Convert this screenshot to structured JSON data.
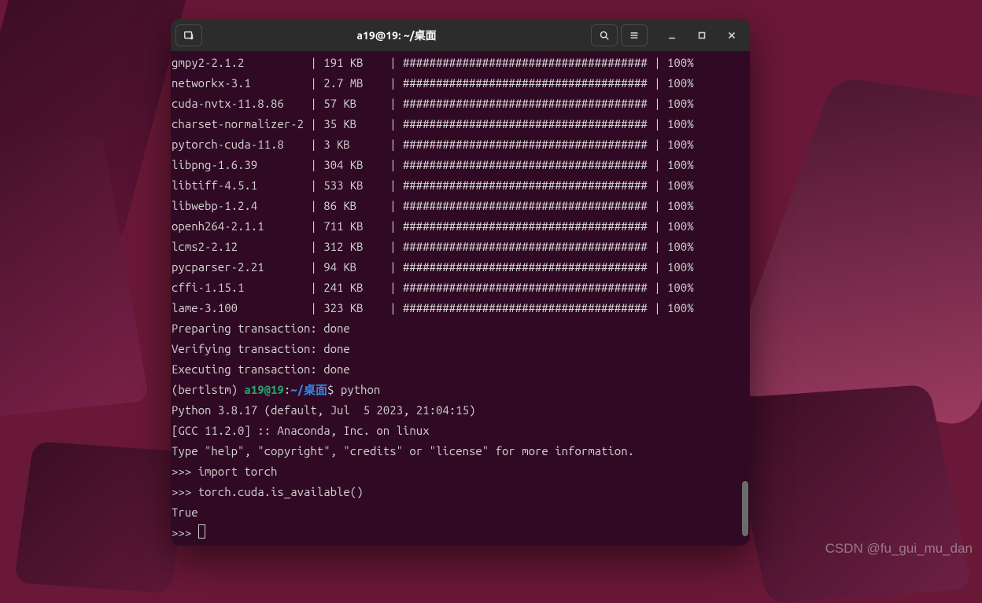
{
  "window": {
    "title": "a19@19: ~/桌面"
  },
  "downloads": [
    {
      "pkg": "gmpy2-2.1.2",
      "size": "191 KB",
      "bar": "#####################################",
      "pct": "100%"
    },
    {
      "pkg": "networkx-3.1",
      "size": "2.7 MB",
      "bar": "#####################################",
      "pct": "100%"
    },
    {
      "pkg": "cuda-nvtx-11.8.86",
      "size": "57 KB",
      "bar": "#####################################",
      "pct": "100%"
    },
    {
      "pkg": "charset-normalizer-2",
      "size": "35 KB",
      "bar": "#####################################",
      "pct": "100%"
    },
    {
      "pkg": "pytorch-cuda-11.8",
      "size": "3 KB",
      "bar": "#####################################",
      "pct": "100%"
    },
    {
      "pkg": "libpng-1.6.39",
      "size": "304 KB",
      "bar": "#####################################",
      "pct": "100%"
    },
    {
      "pkg": "libtiff-4.5.1",
      "size": "533 KB",
      "bar": "#####################################",
      "pct": "100%"
    },
    {
      "pkg": "libwebp-1.2.4",
      "size": "86 KB",
      "bar": "#####################################",
      "pct": "100%"
    },
    {
      "pkg": "openh264-2.1.1",
      "size": "711 KB",
      "bar": "#####################################",
      "pct": "100%"
    },
    {
      "pkg": "lcms2-2.12",
      "size": "312 KB",
      "bar": "#####################################",
      "pct": "100%"
    },
    {
      "pkg": "pycparser-2.21",
      "size": "94 KB",
      "bar": "#####################################",
      "pct": "100%"
    },
    {
      "pkg": "cffi-1.15.1",
      "size": "241 KB",
      "bar": "#####################################",
      "pct": "100%"
    },
    {
      "pkg": "lame-3.100",
      "size": "323 KB",
      "bar": "#####################################",
      "pct": "100%"
    }
  ],
  "transaction": {
    "preparing": "Preparing transaction: done",
    "verifying": "Verifying transaction: done",
    "executing": "Executing transaction: done"
  },
  "prompt": {
    "env": "(bertlstm) ",
    "user": "a19@19",
    "colon": ":",
    "path": "~/桌面",
    "dollar": "$ ",
    "cmd": "python"
  },
  "python": {
    "version": "Python 3.8.17 (default, Jul  5 2023, 21:04:15) ",
    "gcc": "[GCC 11.2.0] :: Anaconda, Inc. on linux",
    "help": "Type \"help\", \"copyright\", \"credits\" or \"license\" for more information.",
    "lines": [
      ">>> import torch",
      ">>> torch.cuda.is_available()",
      "True",
      ">>> "
    ]
  },
  "watermark": "CSDN @fu_gui_mu_dan"
}
